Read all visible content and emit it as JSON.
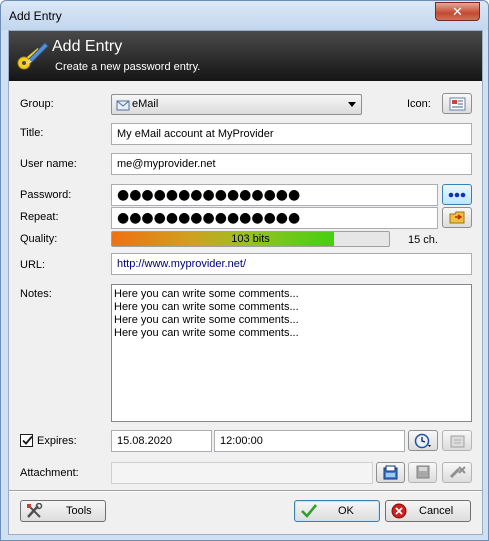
{
  "window": {
    "title": "Add Entry",
    "close_glyph": "✕"
  },
  "banner": {
    "title": "Add Entry",
    "subtitle": "Create a new password entry.",
    "icon": "key-pen-icon"
  },
  "form": {
    "group_label": "Group:",
    "group_value": "eMail",
    "icon_label": "Icon:",
    "title_label": "Title:",
    "title_value": "My eMail account at MyProvider",
    "username_label": "User name:",
    "username_value": "me@myprovider.net",
    "password_label": "Password:",
    "password_value": "●●●●●●●●●●●●●●●",
    "repeat_label": "Repeat:",
    "repeat_value": "●●●●●●●●●●●●●●●",
    "quality_label": "Quality:",
    "quality_text": "103 bits",
    "quality_fraction": 0.8,
    "char_count": "15 ch.",
    "url_label": "URL:",
    "url_value": "http://www.myprovider.net/",
    "notes_label": "Notes:",
    "notes_lines": [
      "Here you can write some comments...",
      "Here you can write some comments...",
      "Here you can write some comments...",
      "Here you can write some comments..."
    ],
    "expires_label": "Expires:",
    "expires_checked": true,
    "expires_date": "15.08.2020",
    "expires_time": "12:00:00",
    "attachment_label": "Attachment:",
    "attachment_value": ""
  },
  "buttons": {
    "tools_label": "Tools",
    "ok_label": "OK",
    "cancel_label": "Cancel"
  },
  "colors": {
    "accent": "#3c7fb1",
    "quality_start": "#f07010",
    "quality_end": "#44d010",
    "link": "#000080"
  }
}
